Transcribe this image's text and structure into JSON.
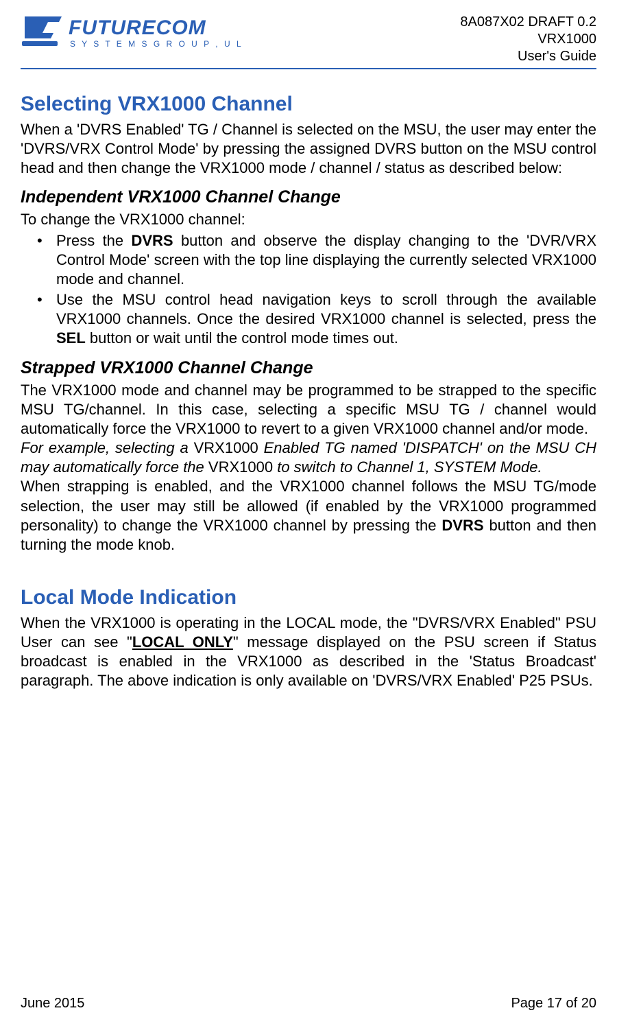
{
  "header": {
    "doc_id": "8A087X02 DRAFT 0.2",
    "product": "VRX1000",
    "title": "User's Guide"
  },
  "section1": {
    "heading": "Selecting VRX1000 Channel",
    "intro_1": "When a 'DVRS Enabled' TG / Channel is selected on the MSU, the user may enter the 'DVRS/VRX Control Mode' by pressing the assigned DVRS button on the MSU control head and then change the VRX1000 mode / channel / status as described below:",
    "sub1_heading": "Independent VRX1000 Channel Change",
    "sub1_intro": "To change the VRX1000 channel:",
    "b1_a": "Press the ",
    "b1_bold": "DVRS",
    "b1_b": " button and observe the display changing to the 'DVR/VRX Control Mode' screen with the top line displaying the currently selected VRX1000 mode and channel.",
    "b2_a": "Use the MSU control head navigation keys to scroll through the available VRX1000 channels. Once the desired VRX1000 channel is selected, press the ",
    "b2_bold": "SEL",
    "b2_b": " button or wait until the control mode times out.",
    "sub2_heading": "Strapped VRX1000 Channel Change",
    "sub2_p1": "The VRX1000 mode and channel may be programmed to be strapped to the specific MSU TG/channel. In this case, selecting a specific MSU TG / channel would automatically force the VRX1000 to revert to a given VRX1000 channel and/or mode.",
    "sub2_ex_i1": "For example, selecting a ",
    "sub2_ex_r1": "VRX1000",
    "sub2_ex_i2": " Enabled TG named 'DISPATCH' on the MSU CH may automatically force the ",
    "sub2_ex_r2": "VRX1000",
    "sub2_ex_i3": " to switch to Channel 1, SYSTEM Mode.",
    "sub2_p3_a": "When strapping is enabled, and the VRX1000 channel follows the MSU TG/mode selection, the user may still be allowed (if enabled by the VRX1000 programmed personality) to change the VRX1000 channel by pressing the ",
    "sub2_p3_bold": "DVRS",
    "sub2_p3_b": " button and then turning the mode knob."
  },
  "section2": {
    "heading": "Local Mode Indication",
    "p_a": "When the VRX1000 is operating in the LOCAL mode, the \"DVRS/VRX Enabled\" PSU User can see \"",
    "p_bold": "LOCAL ONLY",
    "p_b": "\" message displayed on the PSU screen if Status broadcast is enabled in the VRX1000 as described in the 'Status Broadcast' paragraph. The above indication is only available on 'DVRS/VRX Enabled' P25 PSUs."
  },
  "footer": {
    "date": "June 2015",
    "page": "Page 17 of 20"
  }
}
